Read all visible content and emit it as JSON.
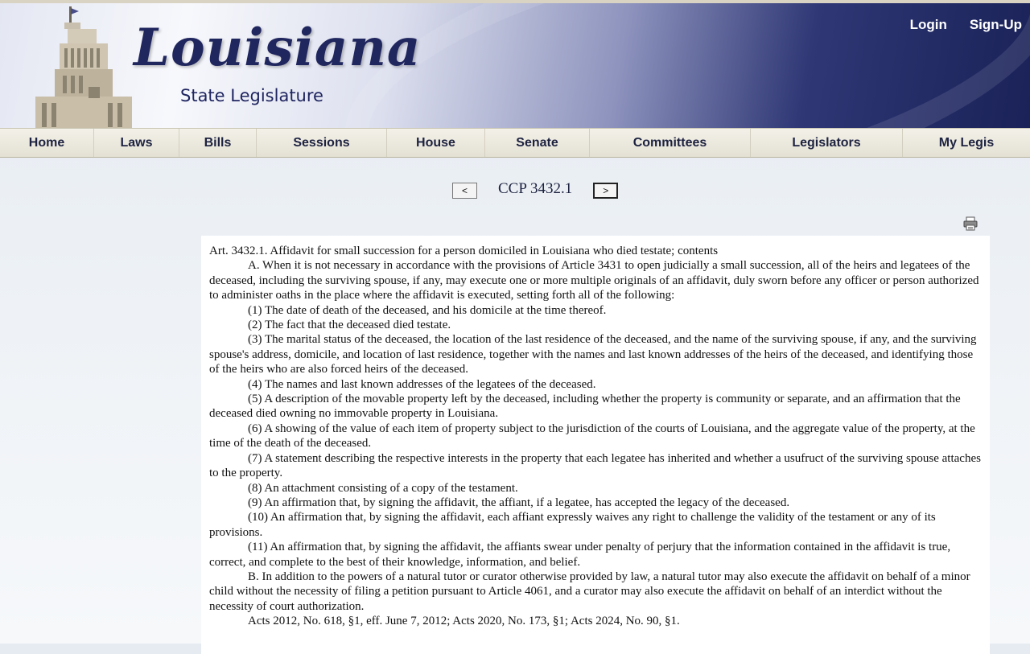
{
  "header": {
    "logo_title": "Louisiana",
    "logo_subtitle": "State Legislature",
    "login": "Login",
    "signup": "Sign-Up"
  },
  "nav": [
    {
      "label": "Home"
    },
    {
      "label": "Laws"
    },
    {
      "label": "Bills"
    },
    {
      "label": "Sessions"
    },
    {
      "label": "House"
    },
    {
      "label": "Senate"
    },
    {
      "label": "Committees"
    },
    {
      "label": "Legislators"
    },
    {
      "label": "My Legis"
    }
  ],
  "pager": {
    "prev": "<",
    "title": "CCP 3432.1",
    "next": ">"
  },
  "document": {
    "heading": "Art. 3432.1. Affidavit for small succession for a person domiciled in Louisiana who died testate; contents",
    "paragraphs": [
      "A. When it is not necessary in accordance with the provisions of Article 3431 to open judicially a small succession, all of the heirs and legatees of the deceased, including the surviving spouse, if any, may execute one or more multiple originals of an affidavit, duly sworn before any officer or person authorized to administer oaths in the place where the affidavit is executed, setting forth all of the following:",
      "(1) The date of death of the deceased, and his domicile at the time thereof.",
      "(2) The fact that the deceased died testate.",
      "(3) The marital status of the deceased, the location of the last residence of the deceased, and the name of the surviving spouse, if any, and the surviving spouse's address, domicile, and location of last residence, together with the names and last known addresses of the heirs of the deceased, and identifying those of the heirs who are also forced heirs of the deceased.",
      "(4) The names and last known addresses of the legatees of the deceased.",
      "(5) A description of the movable property left by the deceased, including whether the property is community or separate, and an affirmation that the deceased died owning no immovable property in Louisiana.",
      "(6) A showing of the value of each item of property subject to the jurisdiction of the courts of Louisiana, and the aggregate value of the property, at the time of the death of the deceased.",
      "(7) A statement describing the respective interests in the property that each legatee has inherited and whether a usufruct of the surviving spouse attaches to the property.",
      "(8) An attachment consisting of a copy of the testament.",
      "(9) An affirmation that, by signing the affidavit, the affiant, if a legatee, has accepted the legacy of the deceased.",
      "(10) An affirmation that, by signing the affidavit, each affiant expressly waives any right to challenge the validity of the testament or any of its provisions.",
      "(11) An affirmation that, by signing the affidavit, the affiants swear under penalty of perjury that the information contained in the affidavit is true, correct, and complete to the best of their knowledge, information, and belief.",
      "B. In addition to the powers of a natural tutor or curator otherwise provided by law, a natural tutor may also execute the affidavit on behalf of a minor child without the necessity of filing a petition pursuant to Article 4061, and a curator may also execute the affidavit on behalf of an interdict without the necessity of court authorization.",
      "Acts 2012, No. 618, §1, eff. June 7, 2012; Acts 2020, No. 173, §1; Acts 2024, No. 90, §1."
    ]
  },
  "colors": {
    "banner_dark": "#1a2258",
    "nav_text": "#1d2240",
    "nav_bg": "#ece9de"
  },
  "icons": {
    "print": "printer-icon"
  }
}
